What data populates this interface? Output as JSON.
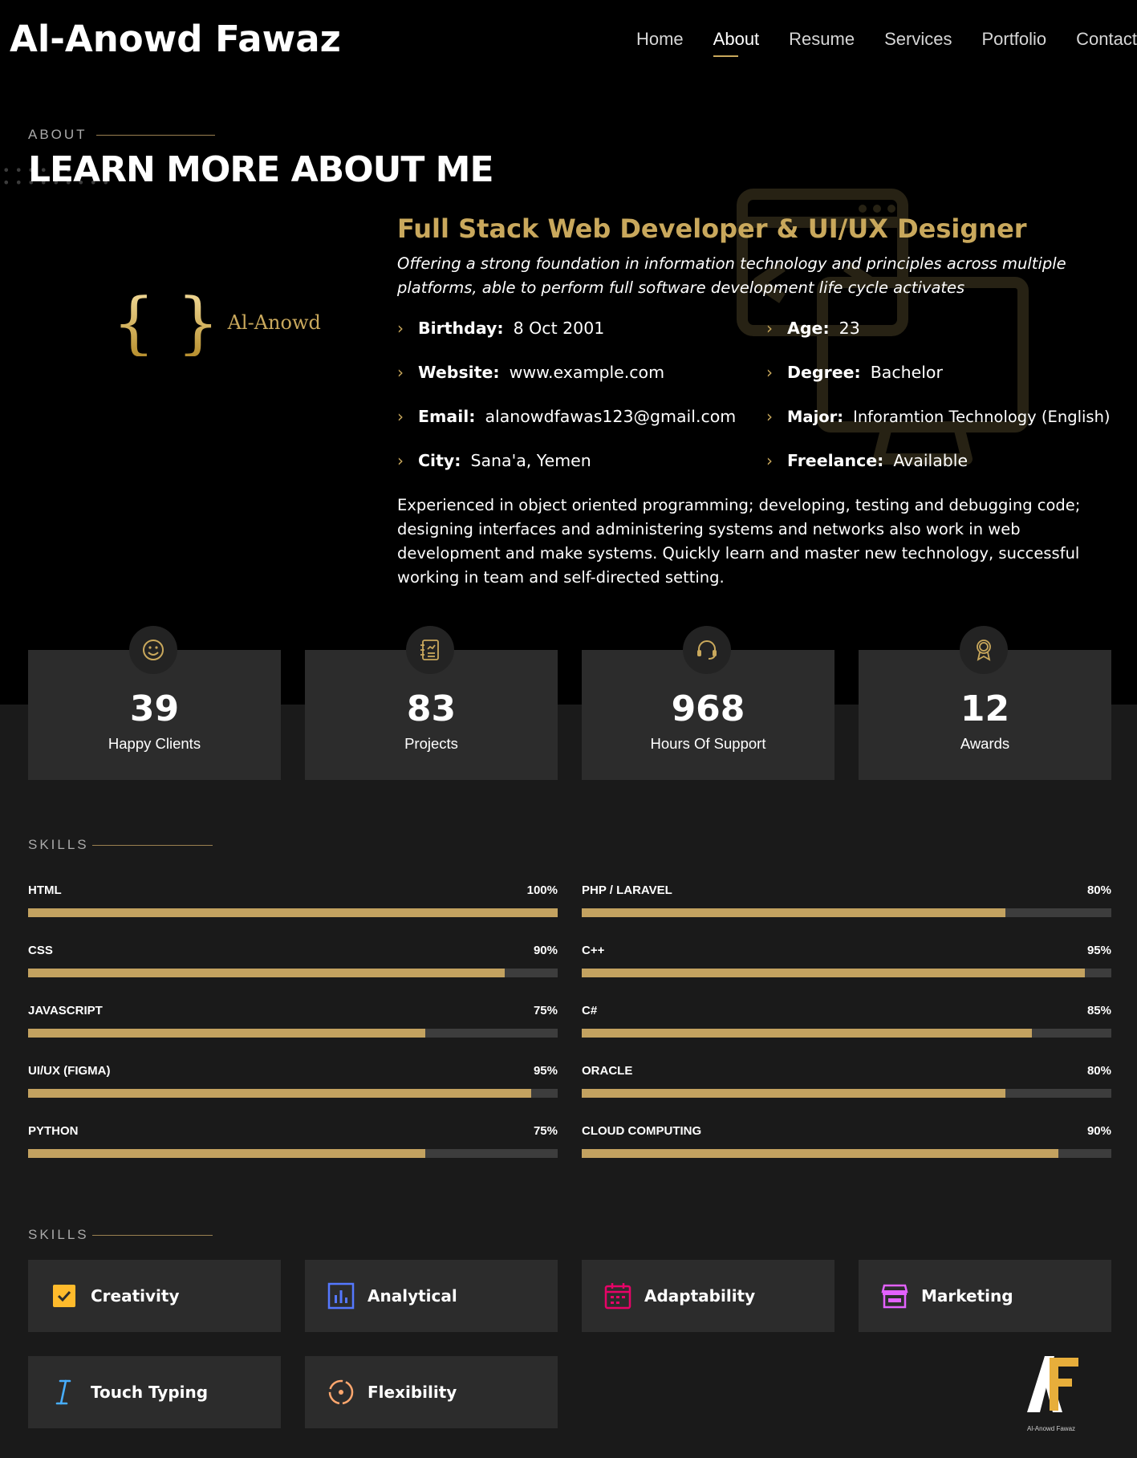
{
  "header": {
    "brand": "Al-Anowd Fawaz",
    "nav": [
      "Home",
      "About",
      "Resume",
      "Services",
      "Portfolio",
      "Contact"
    ],
    "active_nav": "About"
  },
  "about": {
    "label": "ABOUT",
    "title": "LEARN MORE ABOUT ME",
    "logo_text": "Al-Anowd",
    "role": "Full Stack Web Developer & UI/UX Designer",
    "tagline": "Offering a strong foundation in information technology and principles across multiple platforms, able to perform full software development life cycle activates",
    "info_left": [
      {
        "key": "Birthday:",
        "value": "8 Oct 2001"
      },
      {
        "key": "Website:",
        "value": "www.example.com"
      },
      {
        "key": "Email:",
        "value": "alanowdfawas123@gmail.com"
      },
      {
        "key": "City:",
        "value": "Sana'a, Yemen"
      }
    ],
    "info_right": [
      {
        "key": "Age:",
        "value": "23"
      },
      {
        "key": "Degree:",
        "value": "Bachelor"
      },
      {
        "key": "Major:",
        "value": "Inforamtion Technology (English)"
      },
      {
        "key": "Freelance:",
        "value": "Available"
      }
    ],
    "bio": "Experienced in object oriented programming; developing, testing and debugging code; designing interfaces and administering systems and networks also work in web development and make systems. Quickly learn and master new technology, successful working in team and self-directed setting."
  },
  "counters": [
    {
      "icon": "smiley-icon",
      "value": "39",
      "label": "Happy Clients"
    },
    {
      "icon": "journal-icon",
      "value": "83",
      "label": "Projects"
    },
    {
      "icon": "headset-icon",
      "value": "968",
      "label": "Hours Of Support"
    },
    {
      "icon": "award-icon",
      "value": "12",
      "label": "Awards"
    }
  ],
  "skills": {
    "label": "SKILLS",
    "left": [
      {
        "name": "HTML",
        "percent": "100%",
        "level": 100
      },
      {
        "name": "CSS",
        "percent": "90%",
        "level": 90
      },
      {
        "name": "JAVASCRIPT",
        "percent": "75%",
        "level": 75
      },
      {
        "name": "UI/UX (FIGMA)",
        "percent": "95%",
        "level": 95
      },
      {
        "name": "PYTHON",
        "percent": "75%",
        "level": 75
      }
    ],
    "right": [
      {
        "name": "PHP / LARAVEL",
        "percent": "80%",
        "level": 80
      },
      {
        "name": "C++",
        "percent": "95%",
        "level": 95
      },
      {
        "name": "C#",
        "percent": "85%",
        "level": 85
      },
      {
        "name": "ORACLE",
        "percent": "80%",
        "level": 80
      },
      {
        "name": "CLOUD COMPUTING",
        "percent": "90%",
        "level": 90
      }
    ]
  },
  "soft_skills": {
    "label": "SKILLS",
    "items": [
      {
        "icon": "checkbox-icon",
        "label": "Creativity",
        "color": "#ffbb2c"
      },
      {
        "icon": "bar-chart-icon",
        "label": "Analytical",
        "color": "#5578ff"
      },
      {
        "icon": "calendar-icon",
        "label": "Adaptability",
        "color": "#e80368"
      },
      {
        "icon": "shop-icon",
        "label": "Marketing",
        "color": "#e361ff"
      },
      {
        "icon": "text-cursor-icon",
        "label": "Touch Typing",
        "color": "#47aeff"
      },
      {
        "icon": "target-icon",
        "label": "Flexibility",
        "color": "#ffa76e"
      }
    ]
  },
  "footer_logo": {
    "caption": "Al-Anowd Fawaz"
  },
  "colors": {
    "accent": "#c9a85c",
    "background": "#1a1a1a",
    "hero": "#000000",
    "card": "#2c2c2c"
  }
}
